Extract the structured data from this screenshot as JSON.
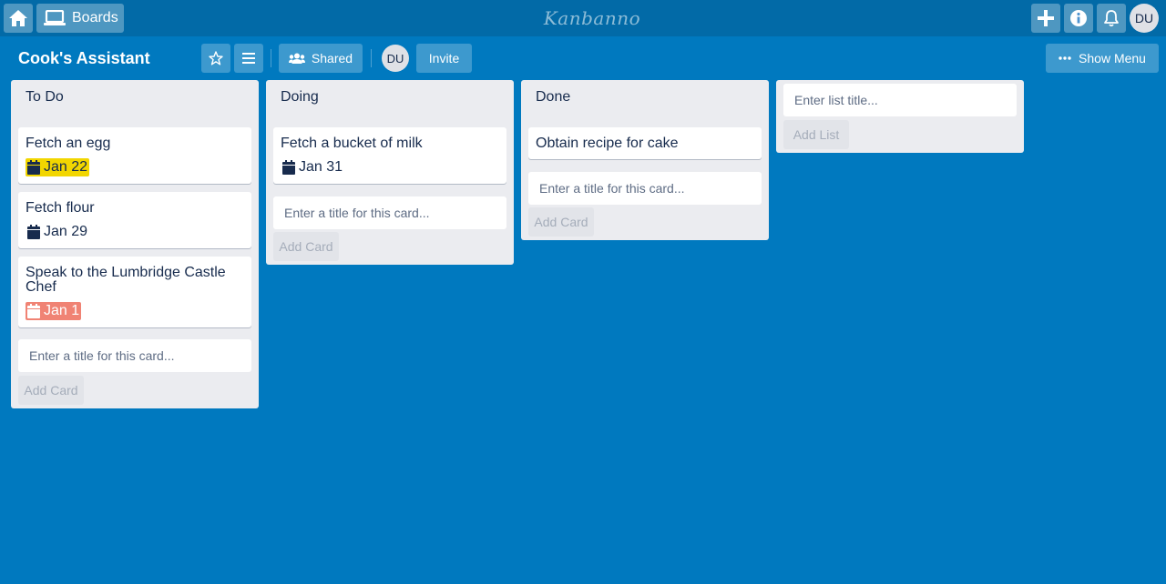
{
  "topbar": {
    "boards_label": "Boards",
    "logo": "Kanbanno",
    "avatar_initials": "DU"
  },
  "board": {
    "title": "Cook's Assistant",
    "shared_label": "Shared",
    "member_initials": "DU",
    "invite_label": "Invite",
    "show_menu_label": "Show Menu"
  },
  "lists": [
    {
      "title": "To Do",
      "cards": [
        {
          "title": "Fetch an egg",
          "due": "Jan 22",
          "due_style": "yellow"
        },
        {
          "title": "Fetch flour",
          "due": "Jan 29",
          "due_style": "plain"
        },
        {
          "title": "Speak to the Lumbridge Castle Chef",
          "due": "Jan 1",
          "due_style": "red"
        }
      ],
      "new_card_placeholder": "Enter a title for this card...",
      "add_card_label": "Add Card"
    },
    {
      "title": "Doing",
      "cards": [
        {
          "title": "Fetch a bucket of milk",
          "due": "Jan 31",
          "due_style": "plain"
        }
      ],
      "new_card_placeholder": "Enter a title for this card...",
      "add_card_label": "Add Card"
    },
    {
      "title": "Done",
      "cards": [
        {
          "title": "Obtain recipe for cake"
        }
      ],
      "new_card_placeholder": "Enter a title for this card...",
      "add_card_label": "Add Card"
    }
  ],
  "new_list": {
    "placeholder": "Enter list title...",
    "add_list_label": "Add List"
  },
  "colors": {
    "background": "#0079bf",
    "topbar": "#026aa7",
    "due_yellow": "#f2d600",
    "due_red": "#eb5a46"
  }
}
